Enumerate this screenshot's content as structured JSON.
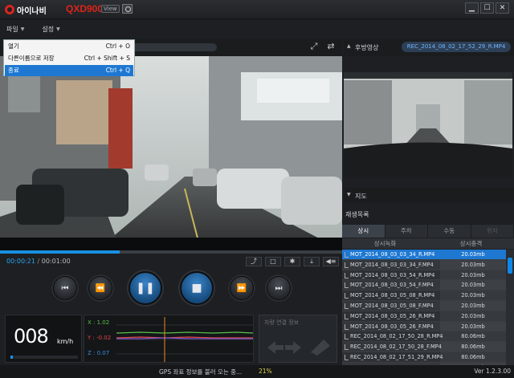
{
  "app": {
    "brand": "아이나비",
    "model": "QXD900",
    "model_badge": "View",
    "version": "Ver 1.2.3.00"
  },
  "window_controls": [
    {
      "name": "minimize",
      "glyph": "▁"
    },
    {
      "name": "maximize",
      "glyph": "☐"
    },
    {
      "name": "close",
      "glyph": "✕"
    }
  ],
  "menu": {
    "file": "파일",
    "settings": "설정",
    "file_items": [
      {
        "label": "열기",
        "shortcut": "Ctrl + O"
      },
      {
        "label": "다른이름으로 저장",
        "shortcut": "Ctrl + Shift + S"
      },
      {
        "label": "종료",
        "shortcut": "Ctrl + Q"
      }
    ]
  },
  "player": {
    "current_time": "00:00:21",
    "separator": "/",
    "total_time": "00:01:00",
    "progress": 0.35,
    "toolbar_icons": [
      "screenshot-icon",
      "fullscreen-icon",
      "settings-icon",
      "download-icon",
      "volume-icon"
    ],
    "transport": [
      "⏮",
      "⏪",
      "❚❚",
      "■",
      "⏩",
      "⏭"
    ]
  },
  "gauges": {
    "speed": "008",
    "speed_unit": "km/h",
    "speed_fraction": 0.04,
    "g_x": "X : 1.02",
    "g_y": "Y : -0.02",
    "g_z": "Z : 0.07",
    "vehicle_title": "차량 연결 정보"
  },
  "rear": {
    "title": "후방영상",
    "file": "REC_2014_08_02_17_52_29_R.MP4"
  },
  "map": {
    "title": "지도"
  },
  "playlist": {
    "title": "재생목록",
    "tabs": [
      "상시",
      "주차",
      "수동",
      "위치"
    ],
    "columns": [
      "상시녹화",
      "상시충격"
    ],
    "rows": [
      {
        "file": "MOT_2014_08_03_03_34_R.MP4",
        "size": "20.03mb"
      },
      {
        "file": "MOT_2014_08_03_03_34_F.MP4",
        "size": "20.03mb"
      },
      {
        "file": "MOT_2014_08_03_03_54_R.MP4",
        "size": "20.03mb"
      },
      {
        "file": "MOT_2014_08_03_03_54_F.MP4",
        "size": "20.03mb"
      },
      {
        "file": "MOT_2014_08_03_05_08_R.MP4",
        "size": "20.03mb"
      },
      {
        "file": "MOT_2014_08_03_05_08_F.MP4",
        "size": "20.03mb"
      },
      {
        "file": "MOT_2014_08_03_05_26_R.MP4",
        "size": "20.03mb"
      },
      {
        "file": "MOT_2014_08_03_05_26_F.MP4",
        "size": "20.03mb"
      },
      {
        "file": "REC_2014_08_02_17_50_28_R.MP4",
        "size": "80.06mb"
      },
      {
        "file": "REC_2014_08_02_17_50_28_F.MP4",
        "size": "80.06mb"
      },
      {
        "file": "REC_2014_08_02_17_51_29_R.MP4",
        "size": "80.06mb"
      },
      {
        "file": "REC_2014_08_02_17_51_29_F.MP4",
        "size": "80.06mb"
      }
    ]
  },
  "status": {
    "text": "GPS 좌표 정보를 불러 오는 중...",
    "percent": "21%"
  },
  "colors": {
    "accent": "#1a8fe0",
    "brand_red": "#e0231a",
    "g_x": "#59c14a",
    "g_y": "#e04848",
    "g_z": "#3a8ee0"
  }
}
